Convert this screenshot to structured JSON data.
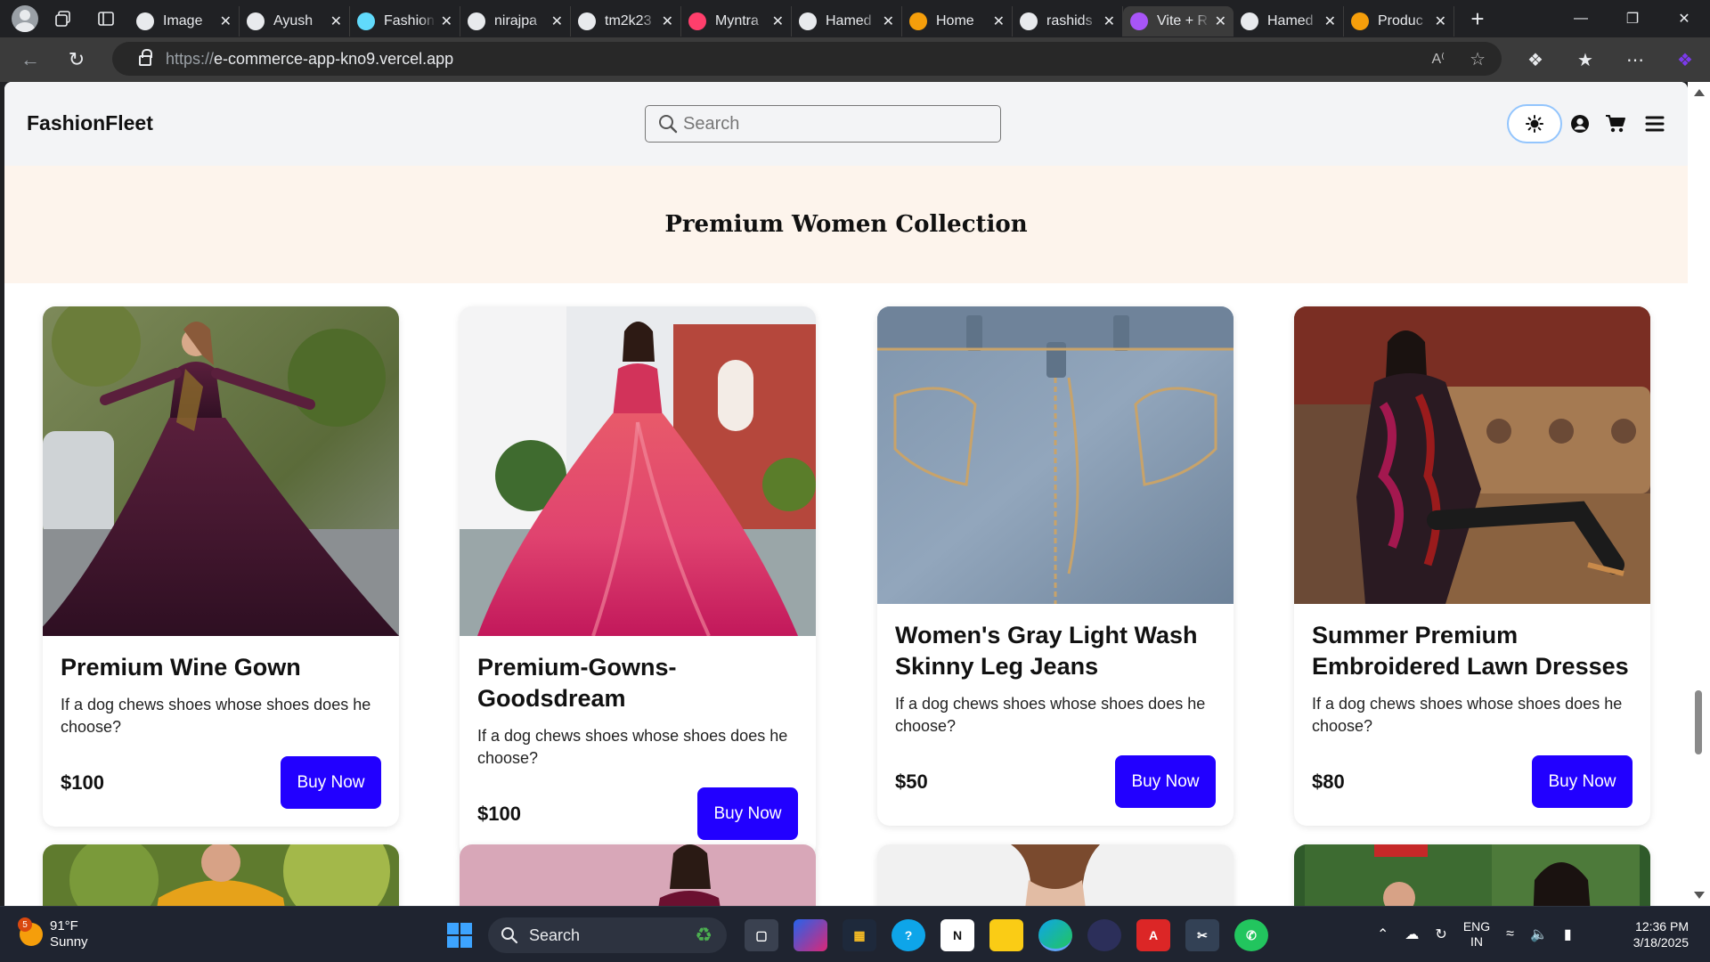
{
  "browser": {
    "tabs": [
      {
        "title": "Image",
        "icon": "openai-icon",
        "color": "#e8eaed"
      },
      {
        "title": "Ayush",
        "icon": "github-icon",
        "color": "#e8eaed"
      },
      {
        "title": "Fashion",
        "icon": "react-icon",
        "color": "#61dafb"
      },
      {
        "title": "nirajpa",
        "icon": "github-icon",
        "color": "#e8eaed"
      },
      {
        "title": "tm2k23",
        "icon": "github-icon",
        "color": "#e8eaed"
      },
      {
        "title": "Myntra",
        "icon": "myntra-icon",
        "color": "#ff3f6c"
      },
      {
        "title": "Hamed",
        "icon": "github-icon",
        "color": "#e8eaed"
      },
      {
        "title": "Home",
        "icon": "stack-icon",
        "color": "#f59e0b"
      },
      {
        "title": "rashids",
        "icon": "github-icon",
        "color": "#e8eaed"
      },
      {
        "title": "Vite + R",
        "icon": "vite-icon",
        "color": "#a855f7"
      },
      {
        "title": "Hamed",
        "icon": "github-icon",
        "color": "#e8eaed"
      },
      {
        "title": "Produc",
        "icon": "stack-icon",
        "color": "#f59e0b"
      }
    ],
    "active_tab_index": 9,
    "url_protocol": "https://",
    "url_host": "e-commerce-app-kno9.vercel.app"
  },
  "site": {
    "logo": "FashionFleet",
    "search_placeholder": "Search",
    "banner_title": "Premium Women Collection",
    "accent_color": "#2200ff"
  },
  "products": [
    {
      "name": "Premium Wine Gown",
      "description": "If a dog chews shoes whose shoes does he choose?",
      "price": "$100",
      "button": "Buy Now"
    },
    {
      "name": "Premium-Gowns-Goodsdream",
      "description": "If a dog chews shoes whose shoes does he choose?",
      "price": "$100",
      "button": "Buy Now"
    },
    {
      "name": "Women's Gray Light Wash Skinny Leg Jeans",
      "description": "If a dog chews shoes whose shoes does he choose?",
      "price": "$50",
      "button": "Buy Now"
    },
    {
      "name": "Summer Premium Embroidered Lawn Dresses",
      "description": "If a dog chews shoes whose shoes does he choose?",
      "price": "$80",
      "button": "Buy Now"
    }
  ],
  "taskbar": {
    "weather_badge": "5",
    "temperature": "91°F",
    "condition": "Sunny",
    "search_label": "Search",
    "lang_line1": "ENG",
    "lang_line2": "IN",
    "time": "12:36 PM",
    "date": "3/18/2025"
  }
}
